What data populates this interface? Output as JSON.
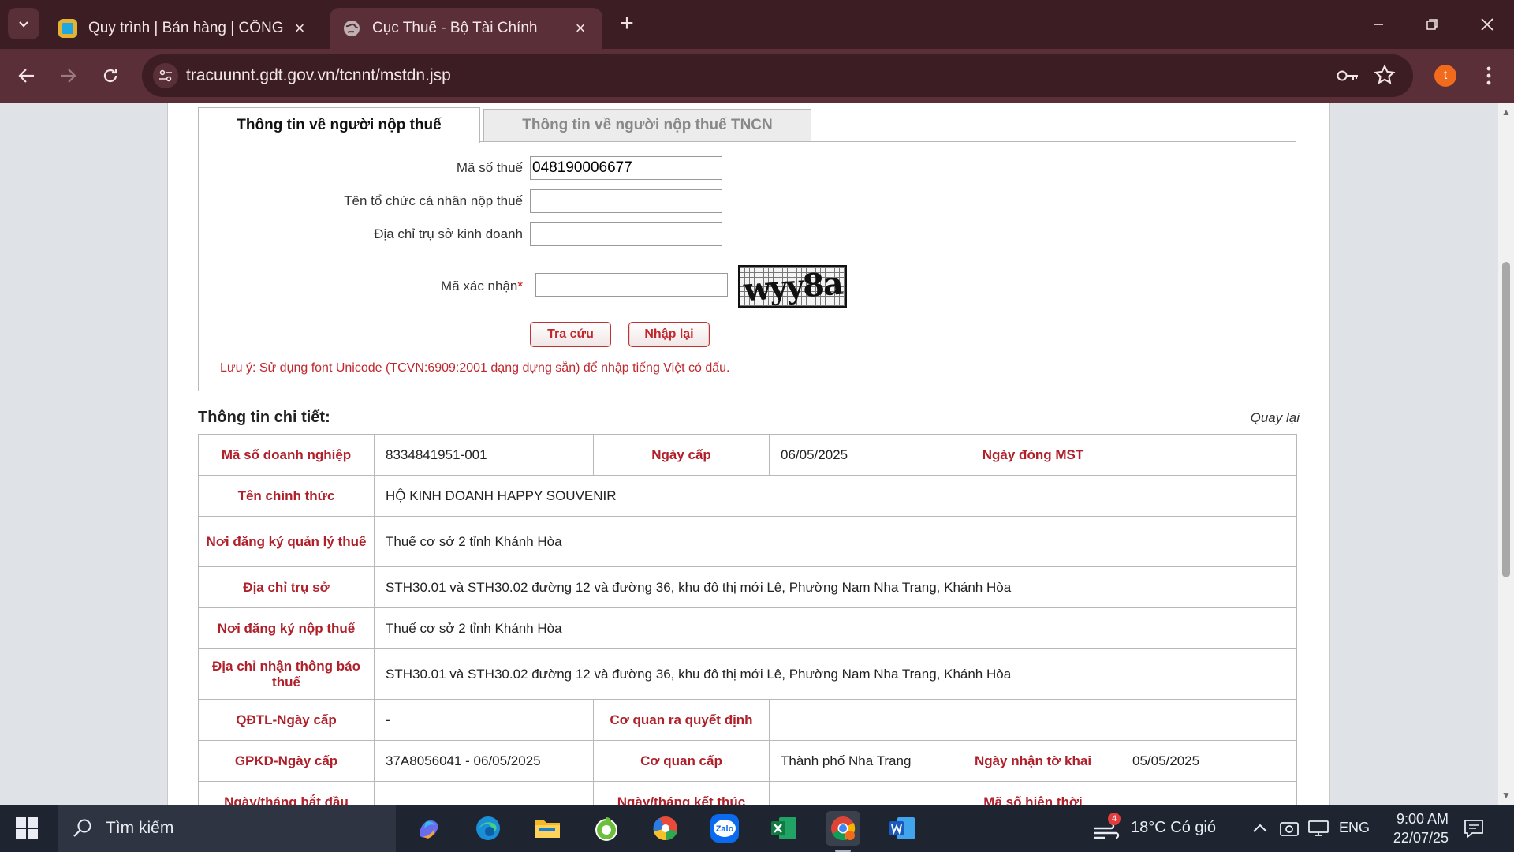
{
  "browser": {
    "tabs": [
      {
        "title": "Quy trình | Bán hàng | CÔNG TY",
        "favicon_color": "#1ea7e0"
      },
      {
        "title": "Cục Thuế - Bộ Tài Chính",
        "favicon_color": "#bfb0b3"
      }
    ],
    "url": "tracuunnt.gdt.gov.vn/tcnnt/mstdn.jsp",
    "profile_initial": "t",
    "icons": {
      "back": "arrow-left-icon",
      "forward": "arrow-right-icon",
      "reload": "reload-icon",
      "site_info": "site-info-icon",
      "password": "key-icon",
      "bookmark": "star-icon",
      "menu": "more-vertical-icon"
    }
  },
  "page": {
    "tabs": [
      "Thông tin về người nộp thuế",
      "Thông tin về người nộp thuế TNCN"
    ],
    "form": {
      "tax_code_label": "Mã số thuế",
      "tax_code_value": "048190006677",
      "name_label": "Tên tổ chức cá nhân nộp thuế",
      "name_value": "",
      "address_label": "Địa chỉ trụ sở kinh doanh",
      "address_value": "",
      "captcha_label": "Mã xác nhận",
      "captcha_required_mark": "*",
      "captcha_value": "",
      "captcha_text": "wyy8a",
      "search_button": "Tra cứu",
      "reset_button": "Nhập lại",
      "note": "Lưu ý: Sử dụng font Unicode (TCVN:6909:2001 dạng dựng sẵn) để nhập tiếng Việt có dấu."
    },
    "detail_title": "Thông tin chi tiết:",
    "back_link": "Quay lại",
    "detail": {
      "r1": [
        "Mã số doanh nghiệp",
        "8334841951-001",
        "Ngày cấp",
        "06/05/2025",
        "Ngày đóng MST",
        ""
      ],
      "r2": [
        "Tên chính thức",
        "HỘ KINH DOANH HAPPY SOUVENIR"
      ],
      "r3": [
        "Nơi đăng ký quản lý thuế",
        "Thuế cơ sở 2 tỉnh Khánh Hòa"
      ],
      "r4": [
        "Địa chỉ trụ sở",
        "STH30.01 và STH30.02 đường 12 và đường 36, khu đô thị mới Lê, Phường Nam Nha Trang, Khánh Hòa"
      ],
      "r5": [
        "Nơi đăng ký nộp thuế",
        "Thuế cơ sở 2 tỉnh Khánh Hòa"
      ],
      "r6": [
        "Địa chỉ nhận thông báo thuế",
        "STH30.01 và STH30.02 đường 12 và đường 36, khu đô thị mới Lê, Phường Nam Nha Trang, Khánh Hòa"
      ],
      "r7": [
        "QĐTL-Ngày cấp",
        "-",
        "Cơ quan ra quyết định",
        ""
      ],
      "r8": [
        "GPKD-Ngày cấp",
        "37A8056041 - 06/05/2025",
        "Cơ quan cấp",
        "Thành phố Nha Trang",
        "Ngày nhận tờ khai",
        "05/05/2025"
      ],
      "r9": [
        "Ngày/tháng bắt đầu",
        "",
        "Ngày/tháng kết thúc",
        "",
        "Mã số hiện thời",
        ""
      ]
    }
  },
  "taskbar": {
    "search_placeholder": "Tìm kiếm",
    "apps": [
      "copilot-icon",
      "edge-icon",
      "file-explorer-icon",
      "coccoc-icon",
      "chrome-alt-icon",
      "zalo-icon",
      "excel-icon",
      "chrome-icon",
      "word-icon"
    ],
    "zalo_label": "Zalo",
    "weather_badge": "4",
    "weather": "18°C  Có gió",
    "language": "ENG",
    "time": "9:00 AM",
    "date": "22/07/25"
  },
  "colors": {
    "chrome_tabbar": "#3b1d23",
    "chrome_toolbar": "#5a2f37",
    "label_red": "#b0202a",
    "taskbar": "#1f2530"
  }
}
